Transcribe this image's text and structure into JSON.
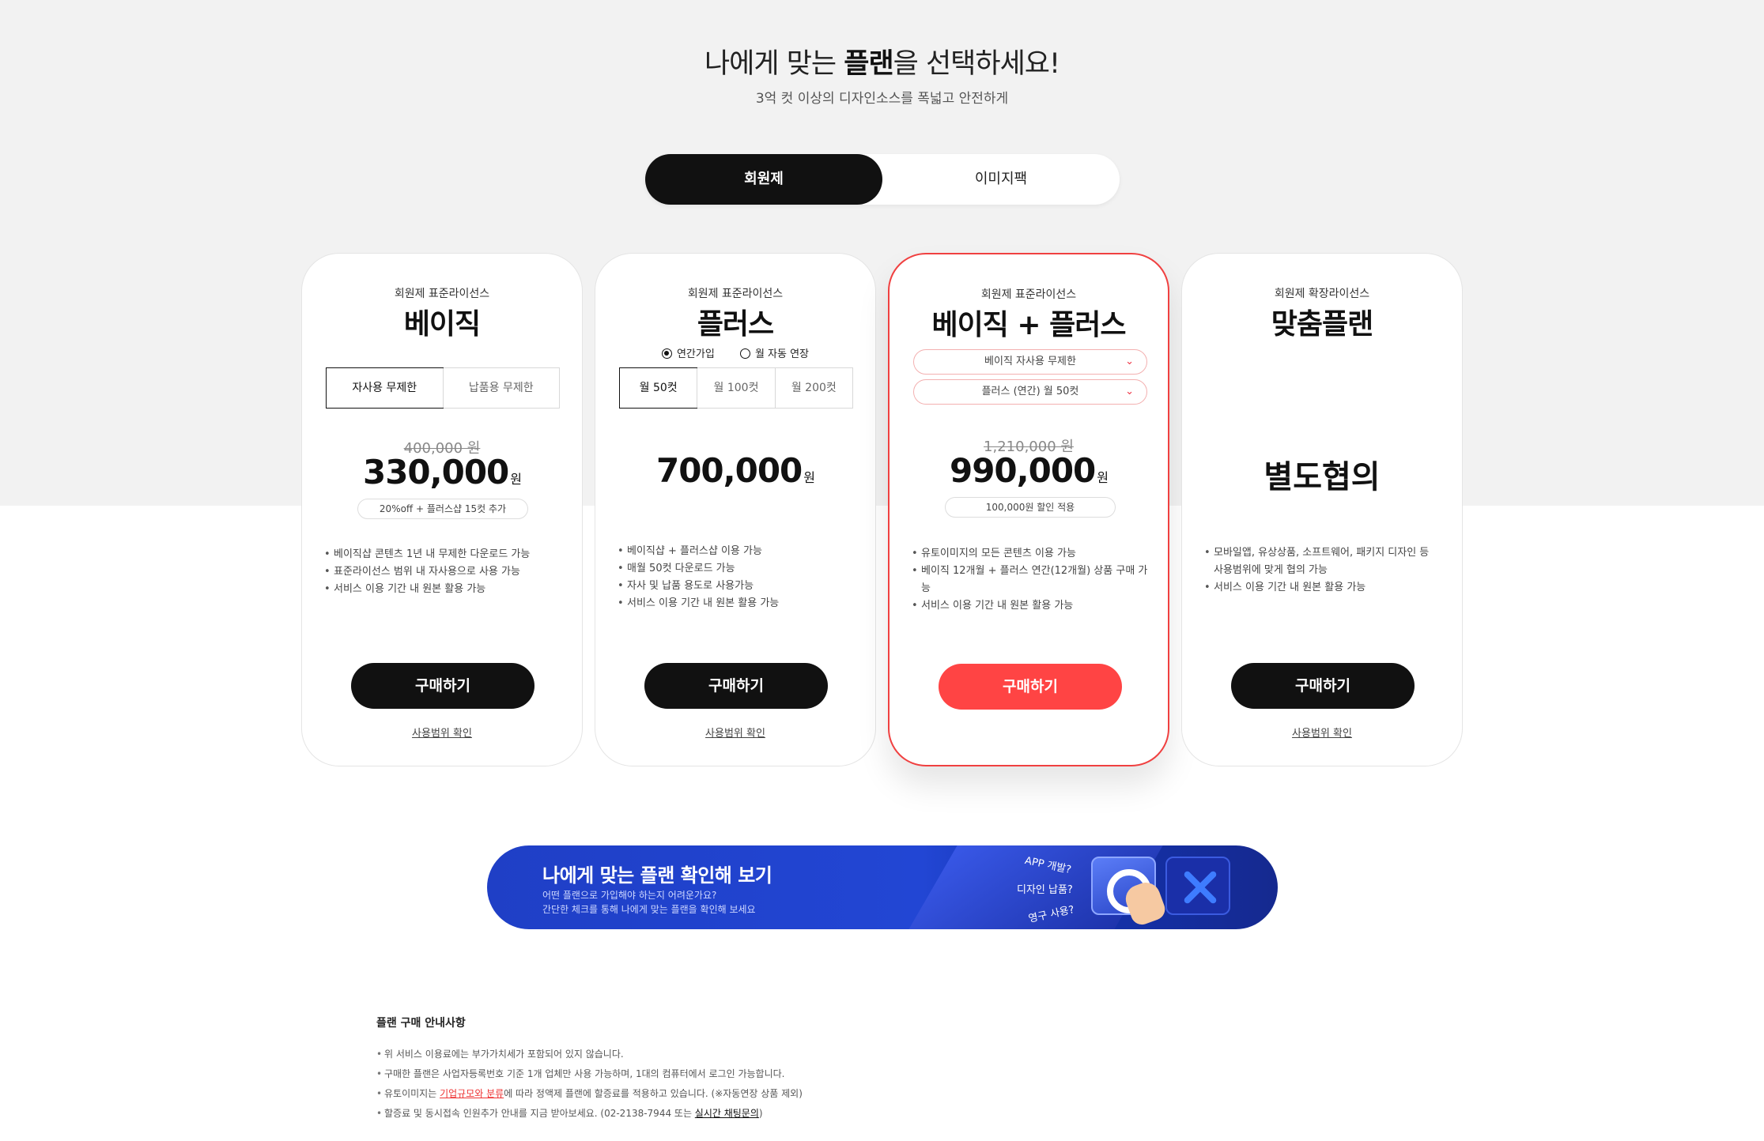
{
  "header": {
    "title_pre": "나에게 맞는 ",
    "title_bold": "플랜",
    "title_post": "을 선택하세요!",
    "subtitle": "3억 컷 이상의 디자인소스를 폭넓고 안전하게"
  },
  "tabs": [
    {
      "label": "회원제",
      "active": true
    },
    {
      "label": "이미지팩",
      "active": false
    }
  ],
  "cards": {
    "basic": {
      "kind": "회원제 표준라이선스",
      "name": "베이직",
      "options": [
        "자사용 무제한",
        "납품용 무제한"
      ],
      "old_price": "400,000 원",
      "price": "330,000",
      "currency": "원",
      "badge": "20%off + 플러스샵 15컷 추가",
      "features": [
        "베이직샵 콘텐츠 1년 내 무제한 다운로드 가능",
        "표준라이선스 범위 내 자사용으로 사용 가능",
        "서비스 이용 기간 내 원본 활용 가능"
      ],
      "buy": "구매하기",
      "usage": "사용범위 확인"
    },
    "plus": {
      "kind": "회원제 표준라이선스",
      "name": "플러스",
      "radios": [
        "연간가입",
        "월 자동 연장"
      ],
      "options": [
        "월 50컷",
        "월 100컷",
        "월 200컷"
      ],
      "price": "700,000",
      "currency": "원",
      "features": [
        "베이직샵 + 플러스샵 이용 가능",
        "매월 50컷 다운로드 가능",
        "자사 및 납품 용도로 사용가능",
        "서비스 이용 기간 내 원본 활용 가능"
      ],
      "buy": "구매하기",
      "usage": "사용범위 확인"
    },
    "combo": {
      "kind": "회원제 표준라이선스",
      "name": "베이직 + 플러스",
      "dropdown1": "베이직 자사용 무제한",
      "dropdown2": "플러스 (연간) 월 50컷",
      "old_price": "1,210,000 원",
      "price": "990,000",
      "currency": "원",
      "badge": "100,000원 할인 적용",
      "features": [
        "유토이미지의 모든 콘텐츠 이용 가능",
        "베이직 12개월 + 플러스 연간(12개월) 상품 구매 가능",
        "서비스 이용 기간 내 원본 활용 가능"
      ],
      "buy": "구매하기",
      "usage": ""
    },
    "custom": {
      "kind": "회원제 확장라이선스",
      "name": "맞춤플랜",
      "price_text": "별도협의",
      "features": [
        "모바일앱, 유상상품, 소프트웨어, 패키지 디자인 등 사용범위에 맞게 협의 가능",
        "서비스 이용 기간 내 원본 활용 가능"
      ],
      "buy": "구매하기",
      "usage": "사용범위 확인"
    }
  },
  "banner": {
    "title": "나에게 맞는 플랜 확인해 보기",
    "sub1": "어떤 플랜으로 가입해야 하는지  어려운가요?",
    "sub2": "간단한 체크를 통해 나에게 맞는 플랜을 확인해 보세요",
    "q1": "APP 개발?",
    "q2": "디자인 납품?",
    "q3": "영구 사용?"
  },
  "notes": {
    "title": "플랜 구매 안내사항",
    "line1": "위 서비스 이용료에는 부가가치세가 포함되어 있지 않습니다.",
    "line2": "구매한 플랜은 사업자등록번호 기준 1개 업체만 사용 가능하며, 1대의 컴퓨터에서 로그인 가능합니다.",
    "line3_pre": "유토이미지는 ",
    "line3_link": "기업규모와 분류",
    "line3_post": "에 따라 정액제 플랜에 할증료를 적용하고 있습니다. (※자동연장 상품 제외)",
    "line4_pre": "할증료 및 동시접속 인원추가 안내를 지금 받아보세요. (02-2138-7944 또는 ",
    "line4_link": "실시간 채팅문의",
    "line4_post": ")"
  },
  "colors": {
    "accent": "#ff4444",
    "dark": "#111111",
    "banner_blue": "#2246d4"
  }
}
